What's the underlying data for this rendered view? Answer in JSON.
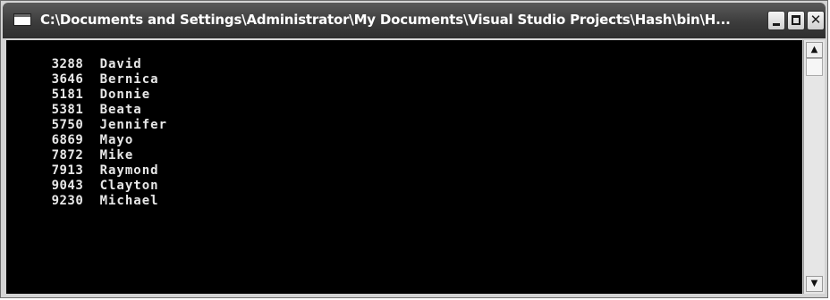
{
  "window": {
    "title": "C:\\Documents and Settings\\Administrator\\My Documents\\Visual Studio Projects\\Hash\\bin\\H...",
    "close_glyph": "✕"
  },
  "console": {
    "lines": [
      {
        "id": "3288",
        "name": "David"
      },
      {
        "id": "3646",
        "name": "Bernica"
      },
      {
        "id": "5181",
        "name": "Donnie"
      },
      {
        "id": "5381",
        "name": "Beata"
      },
      {
        "id": "5750",
        "name": "Jennifer"
      },
      {
        "id": "6869",
        "name": "Mayo"
      },
      {
        "id": "7872",
        "name": "Mike"
      },
      {
        "id": "7913",
        "name": "Raymond"
      },
      {
        "id": "9043",
        "name": "Clayton"
      },
      {
        "id": "9230",
        "name": "Michael"
      }
    ]
  },
  "scrollbar": {
    "up_glyph": "▲",
    "down_glyph": "▼"
  },
  "icons": [
    "console-window-icon",
    "minimize-icon",
    "maximize-icon",
    "close-icon",
    "scroll-up-icon",
    "scroll-down-icon"
  ],
  "colors": {
    "titlebar": "#3c3c3c",
    "console_background": "#000000",
    "console_text": "#e8e8e8"
  }
}
